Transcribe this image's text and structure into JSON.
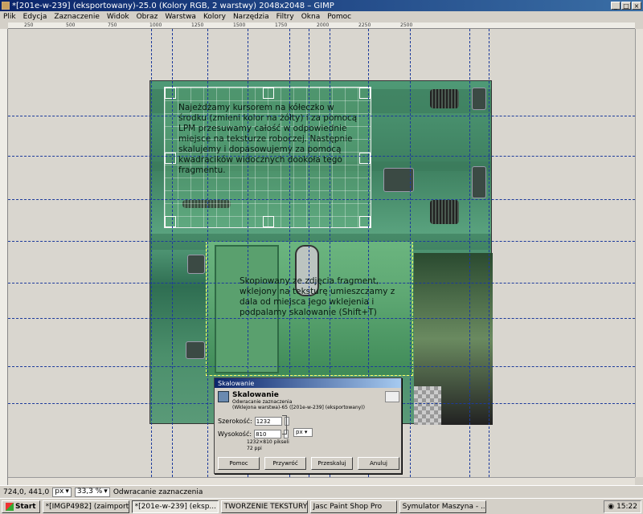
{
  "window": {
    "title": "*[201e-w-239] (eksportowany)-25.0 (Kolory RGB, 2 warstwy) 2048x2048 – GIMP"
  },
  "menu": [
    "Plik",
    "Edycja",
    "Zaznaczenie",
    "Widok",
    "Obraz",
    "Warstwa",
    "Kolory",
    "Narzędzia",
    "Filtry",
    "Okna",
    "Pomoc"
  ],
  "ruler": {
    "h": [
      "250",
      "500",
      "750",
      "1000",
      "1250",
      "1500",
      "1750",
      "2000",
      "2250",
      "2500"
    ]
  },
  "notes": {
    "top": "Najeżdżamy kursorem na kółeczko w środku (zmieni kolor na żółty) i za pomocą LPM przesuwamy całość w odpowiednie miejsce na teksturze roboczej. Następnie skalujemy i dopasowujemy za pomocą kwadracików widocznych dookoła tego fragmentu.",
    "bottom": "Skopiowany ze zdjęcia fragment, wklejony na teksturę umieszczamy z dala od miejsca jego wklejenia i podpalamy skalowanie (Shift+T)"
  },
  "dialog": {
    "title": "Skalowanie",
    "heading": "Skalowanie",
    "subheading": "Odwracanie zaznaczenia",
    "layer": "(Wklejona warstwa)-65 ([201e-w-239] (eksportowany))",
    "width_label": "Szerokość:",
    "width_value": "1232",
    "height_label": "Wysokość:",
    "height_value": "810",
    "unit": "px",
    "size_info": "1232×810 pikseli",
    "ppi": "72 ppi",
    "buttons": {
      "help": "Pomoc",
      "reset": "Przywróć",
      "scale": "Przeskaluj",
      "cancel": "Anuluj"
    }
  },
  "status": {
    "coords": "724,0, 441,0",
    "unit": "px",
    "zoom": "33,3 %",
    "message": "Odwracanie zaznaczenia"
  },
  "taskbar": {
    "start": "Start",
    "tasks": [
      "*[IMGP4982] (zaimporto...",
      "*[201e-w-239] (eksp...",
      "TWORZENIE TEKSTURY ...",
      "Jasc Paint Shop Pro",
      "Symulator Maszyna - ..."
    ],
    "clock": "15:22"
  },
  "colors": {
    "guide": "#1c3a9c",
    "title_bar": "#0a246a",
    "selection_border": "#ffff66"
  }
}
